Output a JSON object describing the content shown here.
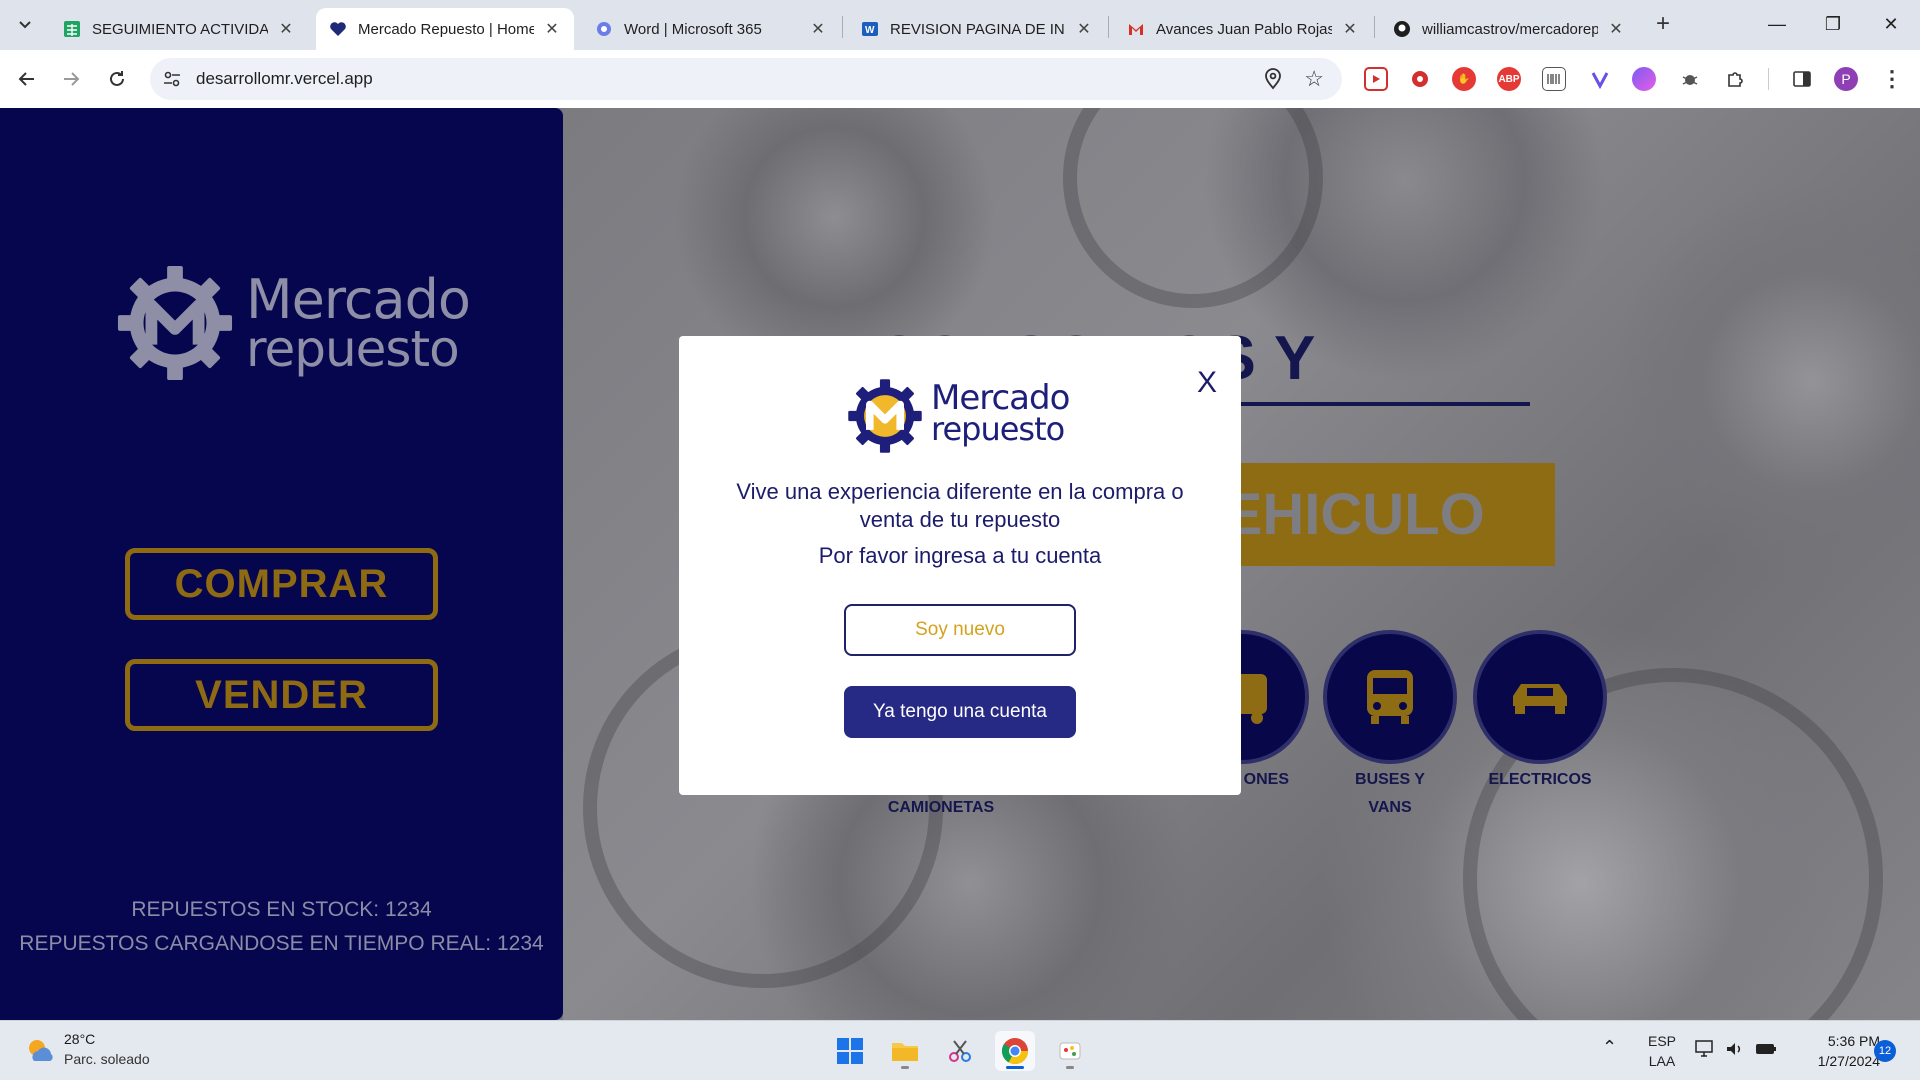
{
  "browser": {
    "tabs": [
      {
        "title": "SEGUIMIENTO ACTIVIDADES",
        "favicon": "sheets-icon",
        "active": false
      },
      {
        "title": "Mercado Repuesto | Home",
        "favicon": "heart-icon",
        "active": true
      },
      {
        "title": "Word | Microsoft 365",
        "favicon": "copilot-icon",
        "active": false
      },
      {
        "title": "REVISION PAGINA DE INICIO",
        "favicon": "word-icon",
        "active": false
      },
      {
        "title": "Avances Juan Pablo Rojas",
        "favicon": "gmail-icon",
        "active": false
      },
      {
        "title": "williamcastrov/mercadorepuesto",
        "favicon": "github-icon",
        "active": false
      }
    ],
    "url": "desarrollomr.vercel.app",
    "profile_initial": "P",
    "extensions": [
      "ABP"
    ]
  },
  "sidebar": {
    "logo_line1": "Mercado",
    "logo_line2": "repuesto",
    "buy_label": "COMPRAR",
    "sell_label": "VENDER",
    "stock_text": "REPUESTOS EN STOCK: 1234",
    "realtime_text": "REPUESTOS CARGANDOSE EN TIEMPO REAL: 1234"
  },
  "main": {
    "hero_title": "ACCESORIOS Y REPUESTOS",
    "hero_cta": "VEHICULO",
    "categories": [
      {
        "label": "CAMIONETAS"
      },
      {
        "label": "ONES"
      },
      {
        "label": "BUSES Y VANS"
      },
      {
        "label": "ELECTRICOS"
      }
    ]
  },
  "modal": {
    "logo_line1": "Mercado",
    "logo_line2": "repuesto",
    "close_label": "X",
    "headline": "Vive una experiencia diferente en la compra o venta de tu repuesto",
    "subtitle": "Por favor ingresa a tu cuenta",
    "new_user_label": "Soy nuevo",
    "login_label": "Ya tengo una cuenta"
  },
  "taskbar": {
    "temperature": "28°C",
    "weather": "Parc. soleado",
    "lang_line1": "ESP",
    "lang_line2": "LAA",
    "time": "5:36 PM",
    "date": "1/27/2024",
    "notifications": "12"
  },
  "colors": {
    "sidebar_bg": "#06064f",
    "gold": "#d5a21d",
    "navy": "#1c1c6a",
    "login_button": "#262a85"
  }
}
